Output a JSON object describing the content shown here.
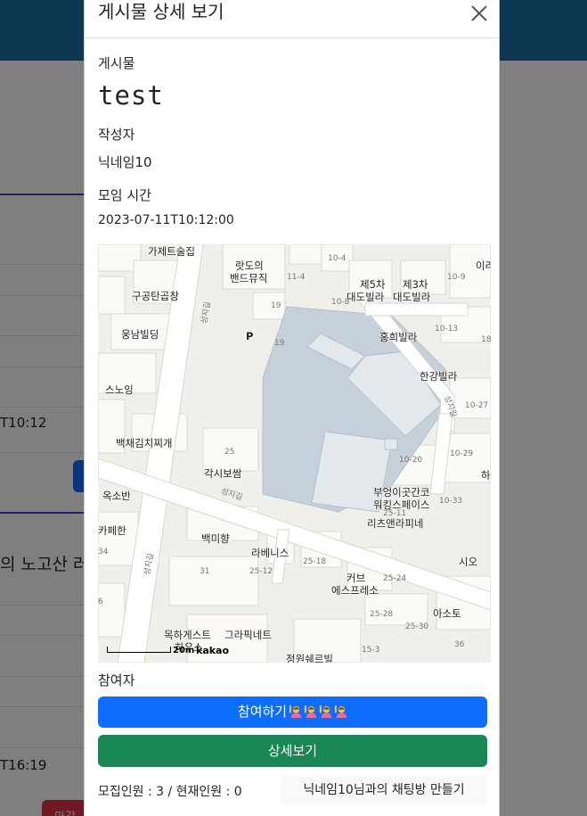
{
  "background": {
    "row_texts": {
      "time_1": "T10:12",
      "heading_2": "의 노고산 러",
      "time_2": "T16:19",
      "badge": "마감"
    }
  },
  "modal": {
    "title": "게시물 상세 보기",
    "post_label": "게시물",
    "post_title": "test",
    "author_label": "작성자",
    "author_value": "닉네임10",
    "meet_time_label": "모임 시간",
    "meet_time_value": "2023-07-11T10:12:00",
    "participants_label": "참여자",
    "join_button": "참여하기",
    "detail_button": "상세보기",
    "recruit_info": "모집인원 : 3 / 현재인원 : 0",
    "chat_button": "닉네임10님과의 채팅방 만들기",
    "participant_icons": [
      "person-raising-hand-icon",
      "person-raising-hand-icon",
      "person-raising-hand-icon",
      "person-raising-hand-icon"
    ]
  },
  "map": {
    "places": {
      "p1": "가제트술집",
      "p2": "랏도의",
      "p3": "밴드뮤직",
      "p4": "제5차",
      "p5": "대도빌라",
      "p6": "제3차",
      "p7": "대도빌라",
      "p8": "구공탄곱창",
      "p9": "웅남빌딩",
      "p10": "홍희빌라",
      "p11": "한강빌라",
      "p12": "스노잉",
      "p13": "백채김치찌개",
      "p14": "각시보쌈",
      "p15": "옥소반",
      "p16": "부엉이곳간코",
      "p17": "워킹스페이스",
      "p18": "리츠앤라피네",
      "p19": "카페한",
      "p20": "백미향",
      "p21": "라베니스",
      "p22": "시오",
      "p23": "커브",
      "p24": "에스프레소",
      "p25": "아소토",
      "p26": "목하게스트",
      "p27": "하우스",
      "p28": "그라픽네트",
      "p29": "정원쉐르빌",
      "p30": "이라",
      "p31": "하"
    },
    "lot_numbers": {
      "n1": "10-4",
      "n2": "11-4",
      "n3": "19",
      "n4": "10-8",
      "n5": "10-9",
      "n6": "10-13",
      "n7": "18",
      "n8": "19",
      "n9": "10-27",
      "n10": "10-20",
      "n11": "10-29",
      "n12": "10-33",
      "n13": "25-11",
      "n14": "25",
      "n15": "25-18",
      "n16": "25-12",
      "n17": "31",
      "n18": "25-24",
      "n19": "25-28",
      "n20": "25-30",
      "n21": "36",
      "n22": "15-3",
      "n23": "34",
      "n24": "6"
    },
    "roads": {
      "r1": "성지길",
      "r2": "성지길",
      "r3": "성지길",
      "r4": "성지길"
    },
    "parking": "P",
    "scale_text": "20m",
    "brand": "kakao"
  }
}
